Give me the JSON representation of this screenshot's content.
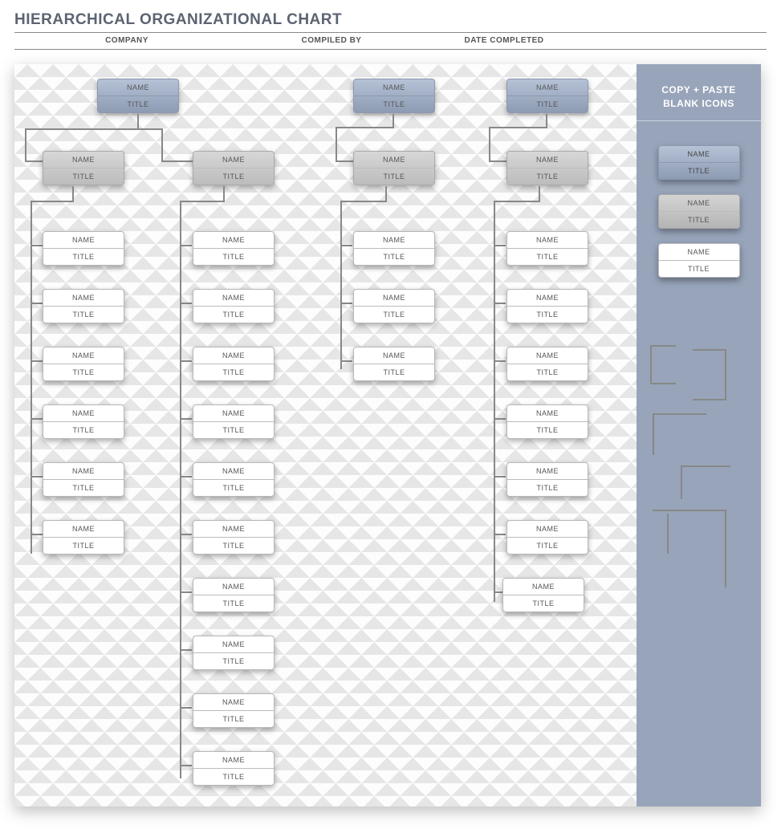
{
  "title": "HIERARCHICAL ORGANIZATIONAL CHART",
  "meta": {
    "company": "COMPANY",
    "compiled": "COMPILED BY",
    "completed": "DATE COMPLETED"
  },
  "labels": {
    "name": "NAME",
    "title": "TITLE"
  },
  "panel": {
    "line1": "COPY + PASTE",
    "line2": "BLANK ICONS"
  },
  "structure": {
    "branches": [
      {
        "top_box": true,
        "level2": [
          {
            "leaves": 6
          },
          {
            "leaves": 10
          }
        ]
      },
      {
        "top_box": true,
        "level2": [
          {
            "leaves": 3
          }
        ],
        "single_column": true
      },
      {
        "top_box": true,
        "level2": [
          {
            "leaves": 7
          }
        ],
        "single_column": true,
        "last_leaf_offset": true
      }
    ]
  }
}
